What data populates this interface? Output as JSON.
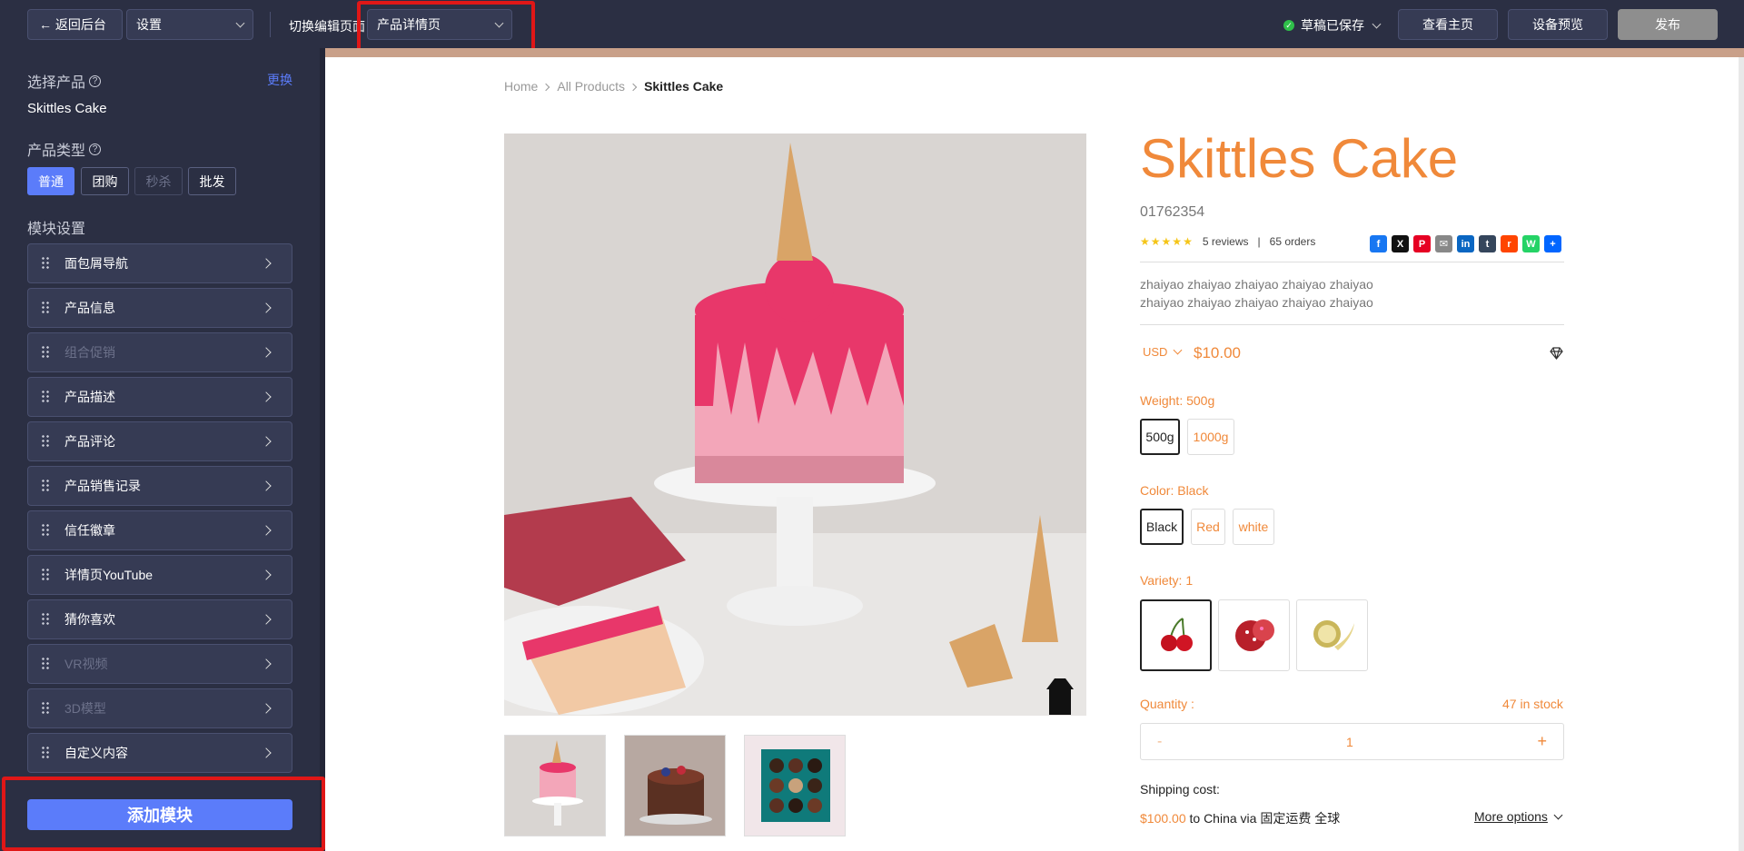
{
  "topbar": {
    "back_label": "← 返回后台",
    "settings_label": "设置",
    "switch_label": "切换编辑页面",
    "page_select": "产品详情页",
    "saved_status": "草稿已保存",
    "view_home": "查看主页",
    "device_preview": "设备预览",
    "publish": "发布"
  },
  "sidebar": {
    "select_product_label": "选择产品",
    "change_label": "更换",
    "product_name": "Skittles Cake",
    "product_type_label": "产品类型",
    "types": [
      "普通",
      "团购",
      "秒杀",
      "批发"
    ],
    "module_settings_label": "模块设置",
    "modules": [
      "面包屑导航",
      "产品信息",
      "组合促销",
      "产品描述",
      "产品评论",
      "产品销售记录",
      "信任徽章",
      "详情页YouTube",
      "猜你喜欢",
      "VR视频",
      "3D模型",
      "自定义内容"
    ],
    "add_module": "添加模块"
  },
  "breadcrumb": {
    "home": "Home",
    "all": "All Products",
    "current": "Skittles Cake"
  },
  "product": {
    "title": "Skittles Cake",
    "sku": "01762354",
    "reviews": "5 reviews",
    "divider": "|",
    "orders": "65 orders",
    "desc_line1": "zhaiyao zhaiyao zhaiyao zhaiyao zhaiyao",
    "desc_line2": "zhaiyao zhaiyao zhaiyao zhaiyao zhaiyao",
    "currency": "USD",
    "price": "$10.00",
    "weight_label": "Weight: 500g",
    "weights": [
      "500g",
      "1000g"
    ],
    "color_label": "Color: Black",
    "colors": [
      "Black",
      "Red",
      "white"
    ],
    "variety_label": "Variety: 1",
    "quantity_label": "Quantity :",
    "stock": "47 in stock",
    "qty_minus": "-",
    "qty_value": "1",
    "qty_plus": "+",
    "shipping_label": "Shipping cost:",
    "shipping_price": "$100.00",
    "shipping_text": " to China via 固定运费 全球",
    "more_options": "More options"
  },
  "share": {
    "labels": [
      "f",
      "X",
      "P",
      "✉",
      "in",
      "t",
      "r",
      "W",
      "+"
    ]
  },
  "colors": {
    "accent": "#f0893a",
    "topbar": "#2b2f43",
    "primary": "#5b7cfa",
    "highlight": "#e01717"
  }
}
